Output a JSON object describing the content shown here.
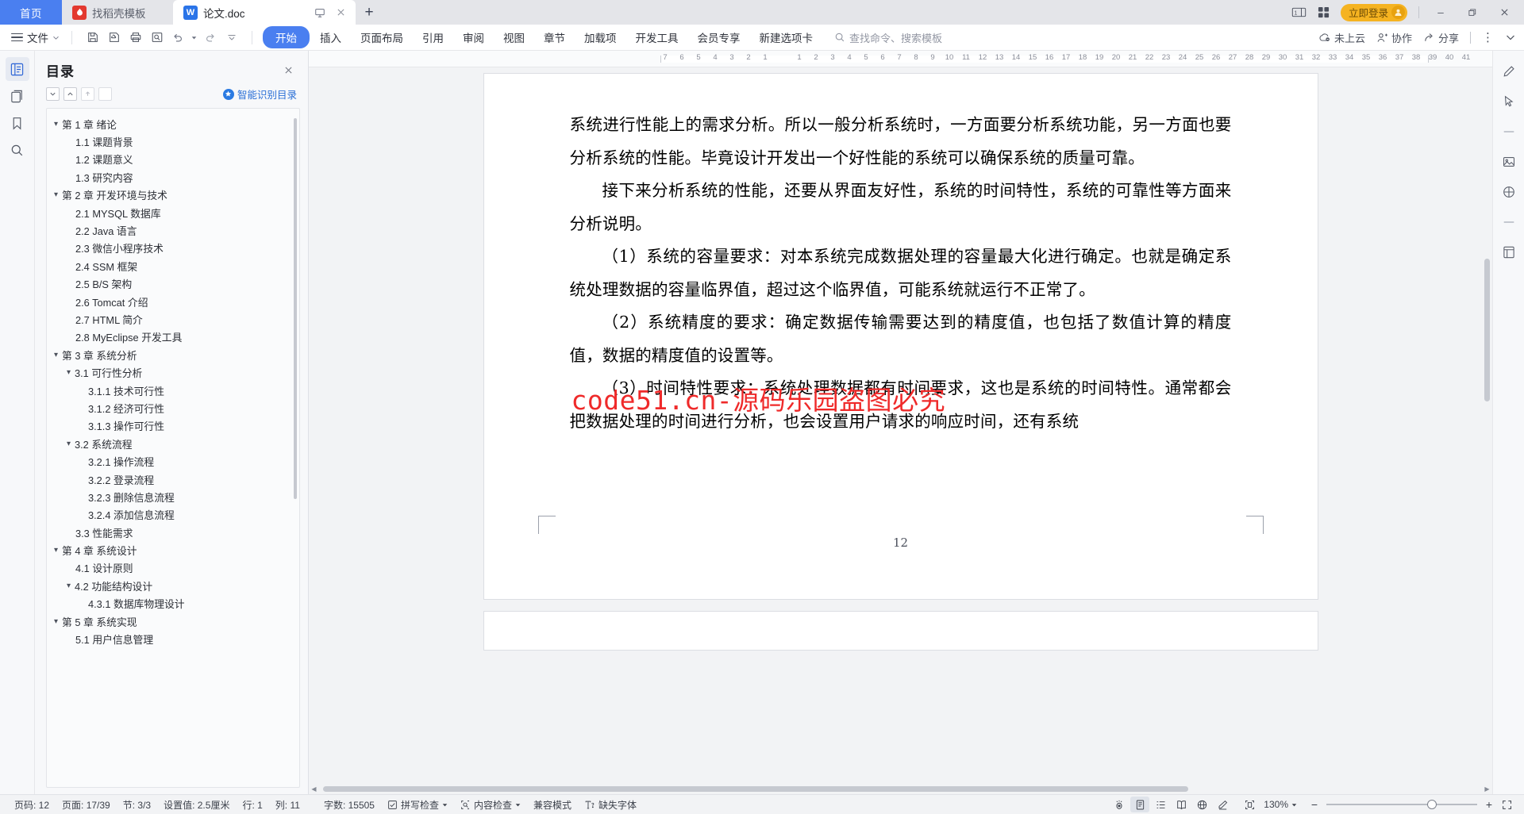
{
  "tabbar": {
    "home_label": "首页",
    "tabs": [
      {
        "label": "找稻壳模板",
        "icon": "wps-docer-icon",
        "state": "inactive"
      },
      {
        "label": "论文.doc",
        "icon": "wps-writer-icon",
        "state": "active"
      }
    ],
    "tab_actions": {
      "present_label": "present-icon",
      "close_label": "close-icon"
    },
    "new_tab_label": "+",
    "login_label": "立即登录",
    "window": {
      "restore_down": "restore-icon",
      "minimize": "−",
      "maximize": "❐",
      "close": "✕"
    }
  },
  "ribbon": {
    "file_label": "文件",
    "quick_access": [
      "save-icon",
      "save-as-cloud-icon",
      "print-icon",
      "print-preview-icon",
      "undo-icon",
      "redo-icon",
      "customize-icon"
    ],
    "tabs": [
      {
        "label": "开始",
        "active": true
      },
      {
        "label": "插入",
        "active": false
      },
      {
        "label": "页面布局",
        "active": false
      },
      {
        "label": "引用",
        "active": false
      },
      {
        "label": "审阅",
        "active": false
      },
      {
        "label": "视图",
        "active": false
      },
      {
        "label": "章节",
        "active": false
      },
      {
        "label": "加载项",
        "active": false
      },
      {
        "label": "开发工具",
        "active": false
      },
      {
        "label": "会员专享",
        "active": false
      },
      {
        "label": "新建选项卡",
        "active": false
      }
    ],
    "search_placeholder": "查找命令、搜索模板",
    "right_items": [
      {
        "label": "未上云",
        "icon": "cloud-off-icon"
      },
      {
        "label": "协作",
        "icon": "collaborate-icon"
      },
      {
        "label": "分享",
        "icon": "share-icon"
      }
    ],
    "overflow_label": "⋮",
    "collapse_label": "⌄"
  },
  "left_rail": [
    {
      "name": "outline-panel-icon",
      "active": true
    },
    {
      "name": "documents-icon",
      "active": false
    },
    {
      "name": "bookmark-icon",
      "active": false
    },
    {
      "name": "search-icon",
      "active": false
    }
  ],
  "toc": {
    "title": "目录",
    "close_label": "✕",
    "tools": [
      "expand-all-icon",
      "collapse-all-icon",
      "promote-icon",
      "demote-icon"
    ],
    "smart_label": "智能识别目录",
    "items": [
      {
        "label": "第 1 章  绪论",
        "level": 1,
        "expandable": true
      },
      {
        "label": "1.1  课题背景",
        "level": 2,
        "expandable": false
      },
      {
        "label": "1.2  课题意义",
        "level": 2,
        "expandable": false
      },
      {
        "label": "1.3  研究内容",
        "level": 2,
        "expandable": false
      },
      {
        "label": "第 2 章  开发环境与技术",
        "level": 1,
        "expandable": true
      },
      {
        "label": "2.1 MYSQL 数据库",
        "level": 2,
        "expandable": false
      },
      {
        "label": "2.2 Java 语言",
        "level": 2,
        "expandable": false
      },
      {
        "label": "2.3  微信小程序技术",
        "level": 2,
        "expandable": false
      },
      {
        "label": "2.4 SSM 框架",
        "level": 2,
        "expandable": false
      },
      {
        "label": "2.5 B/S 架构",
        "level": 2,
        "expandable": false
      },
      {
        "label": "2.6 Tomcat  介绍",
        "level": 2,
        "expandable": false
      },
      {
        "label": "2.7 HTML 简介",
        "level": 2,
        "expandable": false
      },
      {
        "label": "2.8 MyEclipse 开发工具",
        "level": 2,
        "expandable": false
      },
      {
        "label": "第 3 章  系统分析",
        "level": 1,
        "expandable": true
      },
      {
        "label": "3.1  可行性分析",
        "level": 2,
        "expandable": true
      },
      {
        "label": "3.1.1  技术可行性",
        "level": 3,
        "expandable": false
      },
      {
        "label": "3.1.2  经济可行性",
        "level": 3,
        "expandable": false
      },
      {
        "label": "3.1.3  操作可行性",
        "level": 3,
        "expandable": false
      },
      {
        "label": "3.2  系统流程",
        "level": 2,
        "expandable": true
      },
      {
        "label": "3.2.1  操作流程",
        "level": 3,
        "expandable": false
      },
      {
        "label": "3.2.2  登录流程",
        "level": 3,
        "expandable": false
      },
      {
        "label": "3.2.3  删除信息流程",
        "level": 3,
        "expandable": false
      },
      {
        "label": "3.2.4  添加信息流程",
        "level": 3,
        "expandable": false
      },
      {
        "label": "3.3  性能需求",
        "level": 2,
        "expandable": false
      },
      {
        "label": "第 4 章  系统设计",
        "level": 1,
        "expandable": true
      },
      {
        "label": "4.1  设计原则",
        "level": 2,
        "expandable": false
      },
      {
        "label": "4.2  功能结构设计",
        "level": 2,
        "expandable": true
      },
      {
        "label": "4.3.1  数据库物理设计",
        "level": 3,
        "expandable": false
      },
      {
        "label": "第 5 章  系统实现",
        "level": 1,
        "expandable": true
      },
      {
        "label": "5.1 用户信息管理",
        "level": 2,
        "expandable": false
      }
    ]
  },
  "ruler": {
    "left_ticks": [
      "7",
      "6",
      "5",
      "4",
      "3",
      "2",
      "1"
    ],
    "right_ticks": [
      "1",
      "2",
      "3",
      "4",
      "5",
      "6",
      "7",
      "8",
      "9",
      "10",
      "11",
      "12",
      "13",
      "14",
      "15",
      "16",
      "17",
      "18",
      "19",
      "20",
      "21",
      "22",
      "23",
      "24",
      "25",
      "26",
      "27",
      "28",
      "29",
      "30",
      "31",
      "32",
      "33",
      "34",
      "35",
      "36",
      "37",
      "38",
      "39",
      "40",
      "41"
    ]
  },
  "document": {
    "paragraphs": [
      {
        "text": "系统进行性能上的需求分析。所以一般分析系统时，一方面要分析系统功能，另一方面也要分析系统的性能。毕竟设计开发出一个好性能的系统可以确保系统的质量可靠。",
        "indent": false
      },
      {
        "text": "接下来分析系统的性能，还要从界面友好性，系统的时间特性，系统的可靠性等方面来分析说明。",
        "indent": true
      },
      {
        "text": "（1）系统的容量要求：对本系统完成数据处理的容量最大化进行确定。也就是确定系统处理数据的容量临界值，超过这个临界值，可能系统就运行不正常了。",
        "indent": true
      },
      {
        "text": "（2）系统精度的要求：确定数据传输需要达到的精度值，也包括了数值计算的精度值，数据的精度值的设置等。",
        "indent": true
      },
      {
        "text": "（3）时间特性要求：系统处理数据都有时间要求，这也是系统的时间特性。通常都会把数据处理的时间进行分析，也会设置用户请求的响应时间，还有系统",
        "indent": true
      }
    ],
    "watermark": "code51.cn-源码乐园盗图必究",
    "page_footer": "12"
  },
  "right_rail": [
    "edit-pen-icon",
    "cursor-select-icon",
    "separator",
    "image-icon",
    "shape-icon",
    "separator2",
    "page-layout-icon"
  ],
  "status": {
    "items": [
      {
        "label": "页码: 12",
        "name": "page-number"
      },
      {
        "label": "页面: 17/39",
        "name": "page-of-total"
      },
      {
        "label": "节: 3/3",
        "name": "section"
      },
      {
        "label": "设置值: 2.5厘米",
        "name": "setting-value"
      },
      {
        "label": "行: 1",
        "name": "line"
      },
      {
        "label": "列: 11",
        "name": "column"
      },
      {
        "label": "字数: 15505",
        "name": "word-count"
      }
    ],
    "spell_check": "拼写检查",
    "content_check": "内容检查",
    "compat_mode": "兼容模式",
    "missing_font": "缺失字体",
    "view_icons": [
      "eye-protection-icon",
      "page-view-icon",
      "outline-view-icon",
      "reading-view-icon",
      "web-view-icon",
      "markup-icon"
    ],
    "fit_icon": "fit-page-icon",
    "zoom_value": "130%",
    "zoom_minus": "−",
    "zoom_plus": "+",
    "fullscreen_icon": "fullscreen-icon"
  },
  "colors": {
    "accent_blue": "#4a7ff0",
    "login_yellow": "#f5b321",
    "watermark_red": "#ef2a2a",
    "tabbar_bg": "#e4e5e9"
  }
}
